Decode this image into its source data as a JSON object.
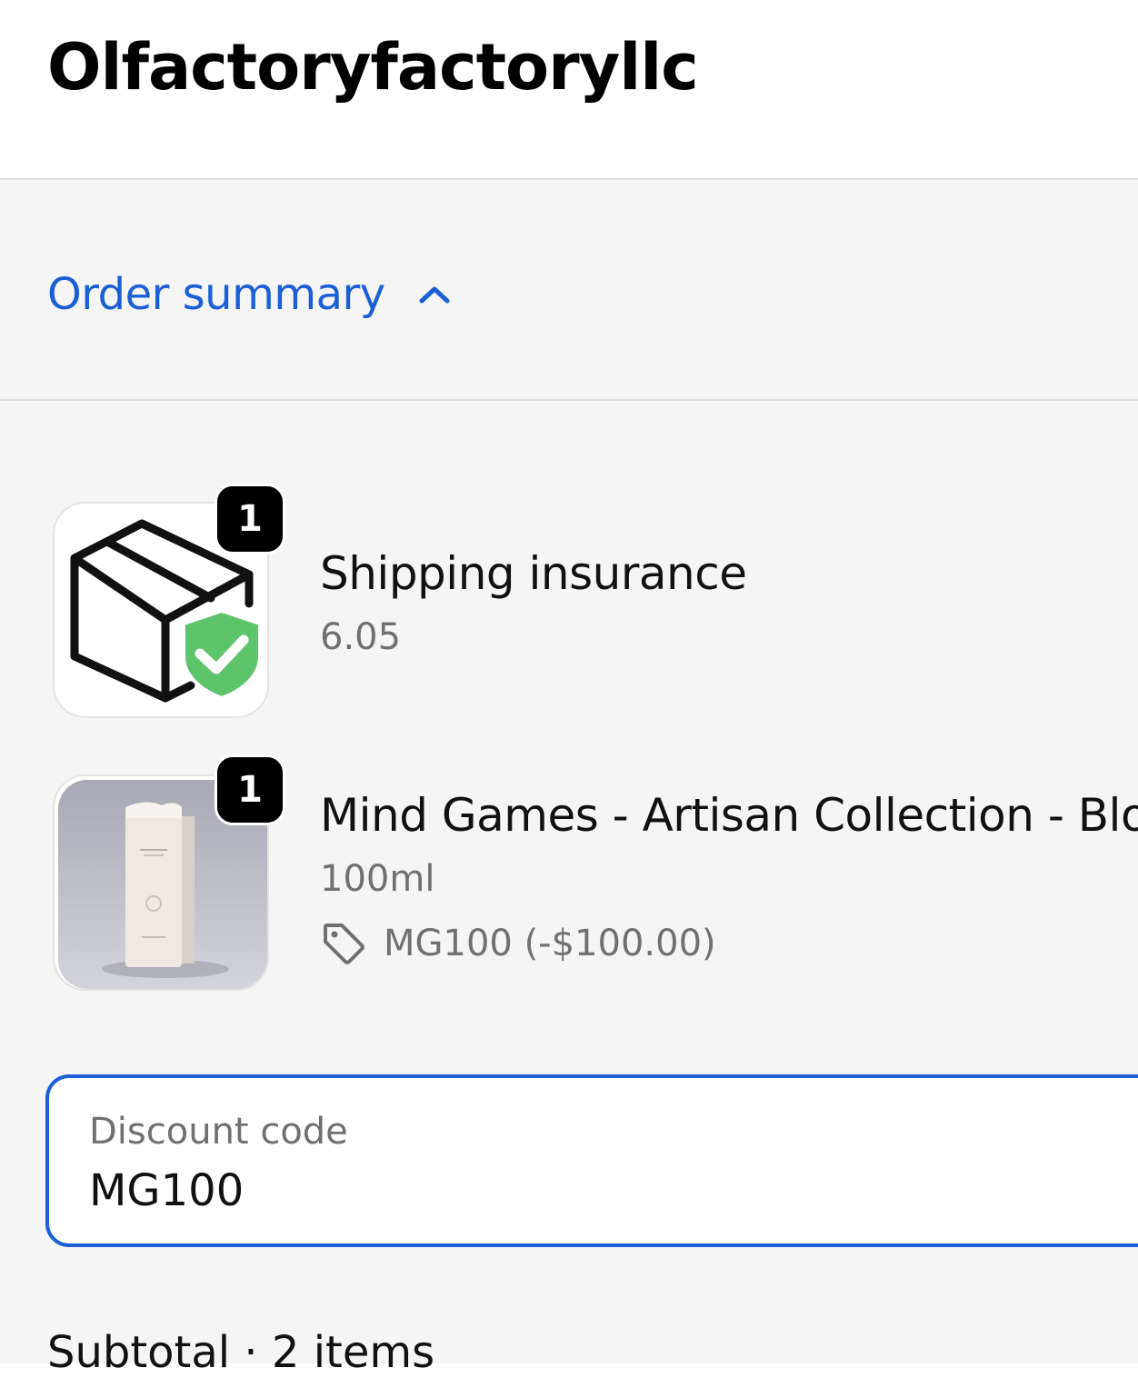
{
  "header": {
    "store_name": "Olfactoryfactoryllc"
  },
  "order_summary": {
    "toggle_label": "Order summary",
    "toggle_icon": "chevron-up-icon",
    "accent_color": "#1a5fd6"
  },
  "line_items": [
    {
      "title": "Shipping insurance",
      "subtitle": "6.05",
      "quantity": "1",
      "image_icon": "package-shield-icon"
    },
    {
      "title": "Mind Games - Artisan Collection - Bloc",
      "subtitle": "100ml",
      "quantity": "1",
      "image_icon": "perfume-bottle-image",
      "discount": {
        "icon": "tag-icon",
        "text": "MG100 (-$100.00)"
      }
    }
  ],
  "discount_field": {
    "label": "Discount code",
    "value": "MG100"
  },
  "subtotal": {
    "label": "Subtotal · 2 items"
  }
}
